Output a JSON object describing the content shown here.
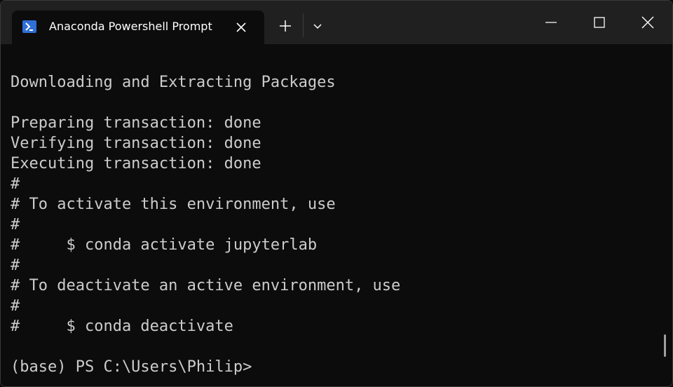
{
  "window": {
    "tab_title": "Anaconda Powershell Prompt"
  },
  "icons": {
    "tab": "powershell-icon",
    "close_tab": "close-icon",
    "new_tab": "plus-icon",
    "dropdown": "chevron-down-icon",
    "minimize": "minimize-icon",
    "maximize": "maximize-icon",
    "close_window": "close-icon"
  },
  "colors": {
    "titlebar": "#202020",
    "terminal_bg": "#0c0c0c",
    "terminal_text": "#cccccc",
    "powershell_icon": "#2f6fd6"
  },
  "terminal": {
    "lines": [
      "Downloading and Extracting Packages",
      "",
      "Preparing transaction: done",
      "Verifying transaction: done",
      "Executing transaction: done",
      "#",
      "# To activate this environment, use",
      "#",
      "#     $ conda activate jupyterlab",
      "#",
      "# To deactivate an active environment, use",
      "#",
      "#     $ conda deactivate",
      "",
      "(base) PS C:\\Users\\Philip>"
    ]
  }
}
